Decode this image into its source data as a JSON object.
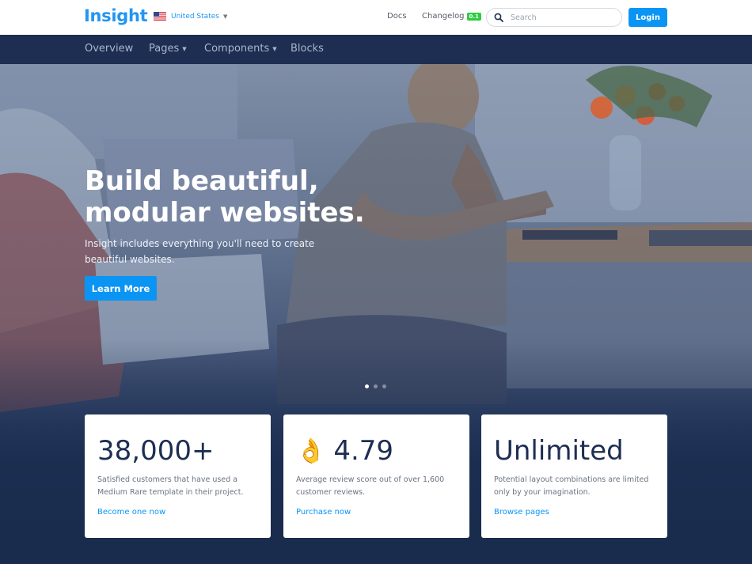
{
  "header": {
    "logo": "Insight",
    "locale": "United States",
    "docs": "Docs",
    "changelog": "Changelog",
    "changelog_badge": "0.1",
    "search_placeholder": "Search",
    "login": "Login"
  },
  "nav": {
    "items": [
      {
        "label": "Overview"
      },
      {
        "label": "Pages"
      },
      {
        "label": "Components"
      },
      {
        "label": "Blocks"
      }
    ]
  },
  "hero": {
    "title_line1": "Build beautiful,",
    "title_line2": "modular websites.",
    "subtitle": "Insight includes everything you'll need to create beautiful websites.",
    "cta": "Learn More",
    "slides_count": 3,
    "active_slide": 1
  },
  "cards": [
    {
      "stat": "38,000+",
      "description": "Satisfied customers that have used a Medium Rare template in their project.",
      "link": "Become one now"
    },
    {
      "icon": "ok-hand-emoji",
      "stat": "4.79",
      "description": "Average review score out of over 1,600 customer reviews.",
      "link": "Purchase now"
    },
    {
      "stat": "Unlimited",
      "description": "Potential layout combinations are limited only by your imagination.",
      "link": "Browse pages"
    }
  ],
  "colors": {
    "brand": "#2196f3",
    "primary_button": "#0a95f4",
    "navbar": "#1d2e52",
    "badge": "#2ecc40"
  }
}
